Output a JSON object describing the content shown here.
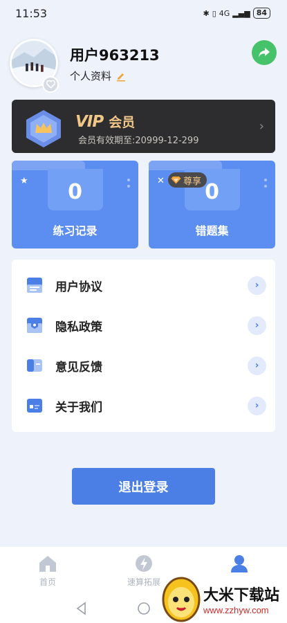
{
  "status_bar": {
    "time": "11:53",
    "signal": "4G",
    "battery": "84"
  },
  "profile": {
    "username": "用户963213",
    "link_label": "个人资料"
  },
  "vip": {
    "logo": "VIP",
    "title": "会员",
    "expire": "会员有效期至:20999-12-299"
  },
  "stats": [
    {
      "value": "0",
      "label": "练习记录"
    },
    {
      "value": "0",
      "label": "错题集",
      "badge": "尊享"
    }
  ],
  "menu": [
    {
      "label": "用户协议",
      "icon": "document-icon"
    },
    {
      "label": "隐私政策",
      "icon": "shield-icon"
    },
    {
      "label": "意见反馈",
      "icon": "chat-icon"
    },
    {
      "label": "关于我们",
      "icon": "info-card-icon"
    }
  ],
  "logout_label": "退出登录",
  "tabbar": {
    "home": "首页",
    "speed": "速算拓展"
  },
  "watermark": {
    "title": "大米下载站",
    "url": "www.zzhyw.com"
  },
  "colors": {
    "accent": "#4b7fe6",
    "card_blue": "#5b8ef0",
    "vip_gold": "#f0c789",
    "share_green": "#46c36a"
  }
}
